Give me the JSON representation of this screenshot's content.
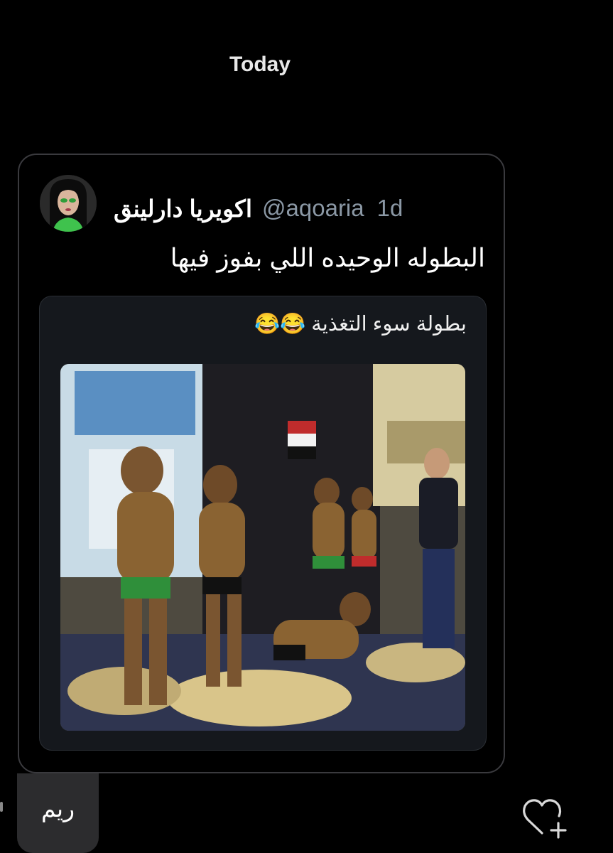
{
  "date_separator": "Today",
  "shared_post": {
    "author": {
      "display_name": "اكويريا دارلينق",
      "handle": "@aqoaria",
      "time": "1d"
    },
    "text": "البطوله الوحيده اللي بفوز فيها",
    "quoted_post": {
      "text": "بطولة سوء التغذية 😂😂"
    }
  },
  "reply": {
    "text": "ريم"
  },
  "icons": {
    "avatar": "profile-avatar",
    "react": "heart-plus-icon"
  },
  "colors": {
    "background": "#000000",
    "secondary_text": "#8b98a5",
    "card_border": "#3a3a3e",
    "quote_background": "#15181d",
    "reply_bubble": "#2c2c2e"
  }
}
